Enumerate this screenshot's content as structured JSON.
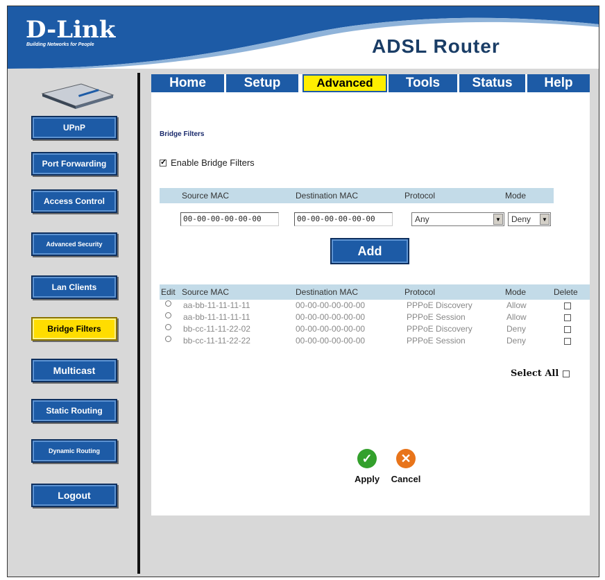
{
  "header": {
    "logo": "D-Link",
    "tagline": "Building Networks for People",
    "product": "ADSL Router"
  },
  "sidebar": {
    "items": [
      {
        "label": "UPnP"
      },
      {
        "label": "Port Forwarding"
      },
      {
        "label": "Access Control"
      },
      {
        "label": "Advanced Security"
      },
      {
        "label": "Lan Clients"
      },
      {
        "label": "Bridge Filters"
      },
      {
        "label": "Multicast"
      },
      {
        "label": "Static Routing"
      },
      {
        "label": "Dynamic Routing"
      },
      {
        "label": "Logout"
      }
    ],
    "active": "Bridge Filters"
  },
  "tabs": [
    {
      "label": "Home"
    },
    {
      "label": "Setup"
    },
    {
      "label": "Advanced"
    },
    {
      "label": "Tools"
    },
    {
      "label": "Status"
    },
    {
      "label": "Help"
    }
  ],
  "active_tab": "Advanced",
  "main": {
    "section_title": "Bridge Filters",
    "enable_label": "Enable Bridge Filters",
    "enable_checked": true,
    "form_headers": {
      "source_mac": "Source MAC",
      "dest_mac": "Destination MAC",
      "protocol": "Protocol",
      "mode": "Mode"
    },
    "form": {
      "source_mac": "00-00-00-00-00-00",
      "dest_mac": "00-00-00-00-00-00",
      "protocol": "Any",
      "mode": "Deny"
    },
    "add_label": "Add",
    "table_headers": {
      "edit": "Edit",
      "source_mac": "Source MAC",
      "dest_mac": "Destination MAC",
      "protocol": "Protocol",
      "mode": "Mode",
      "delete": "Delete"
    },
    "rows": [
      {
        "source": "aa-bb-11-11-11-11",
        "dest": "00-00-00-00-00-00",
        "protocol": "PPPoE Discovery",
        "mode": "Allow"
      },
      {
        "source": "aa-bb-11-11-11-11",
        "dest": "00-00-00-00-00-00",
        "protocol": "PPPoE Session",
        "mode": "Allow"
      },
      {
        "source": "bb-cc-11-11-22-02",
        "dest": "00-00-00-00-00-00",
        "protocol": "PPPoE Discovery",
        "mode": "Deny"
      },
      {
        "source": "bb-cc-11-11-22-22",
        "dest": "00-00-00-00-00-00",
        "protocol": "PPPoE Session",
        "mode": "Deny"
      }
    ],
    "select_all_label": "Select All",
    "apply_label": "Apply",
    "cancel_label": "Cancel"
  },
  "colors": {
    "header_blue": "#1d5ba6",
    "active_yellow": "#ffee00",
    "table_header": "#c3dbe8",
    "apply_green": "#33a02c",
    "cancel_orange": "#e8741a"
  }
}
